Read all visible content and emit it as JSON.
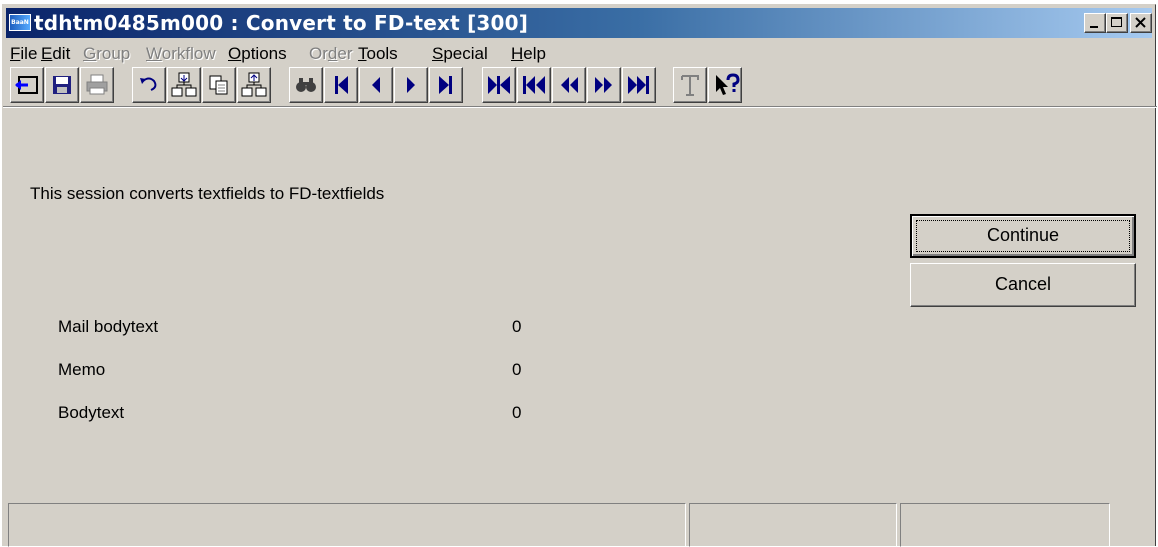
{
  "window": {
    "title": "tdhtm0485m000 : Convert to FD-text [300]",
    "app_icon_text": "BaaN",
    "title_gradient": [
      "#0a246a",
      "#a6caf0"
    ]
  },
  "menu": [
    {
      "label": "File",
      "enabled": true
    },
    {
      "label": "Edit",
      "enabled": true
    },
    {
      "label": "Group",
      "enabled": false
    },
    {
      "label": "Workflow",
      "enabled": false
    },
    {
      "label": "Options",
      "enabled": true
    },
    {
      "label": "Order",
      "enabled": false
    },
    {
      "label": "Tools",
      "enabled": true
    },
    {
      "label": "Special",
      "enabled": true
    },
    {
      "label": "Help",
      "enabled": true
    }
  ],
  "toolbar": [
    "exit-icon",
    "save-icon",
    "print-icon",
    "undo-icon",
    "insert-icon",
    "copy-icon",
    "duplicate-icon",
    "find-icon",
    "first-record-icon",
    "previous-record-icon",
    "next-record-icon",
    "last-record-icon",
    "first-group-icon",
    "previous-set-icon",
    "previous-group-icon",
    "next-group-icon",
    "next-set-icon",
    "text-icon",
    "context-help-icon"
  ],
  "form": {
    "description": "This session converts textfields to FD-textfields",
    "fields": [
      {
        "label": "Mail bodytext",
        "value": "0"
      },
      {
        "label": "Memo",
        "value": "0"
      },
      {
        "label": "Bodytext",
        "value": "0"
      }
    ]
  },
  "buttons": {
    "continue": "Continue",
    "cancel": "Cancel"
  },
  "statusbar": {
    "panels": [
      "",
      "",
      ""
    ]
  }
}
